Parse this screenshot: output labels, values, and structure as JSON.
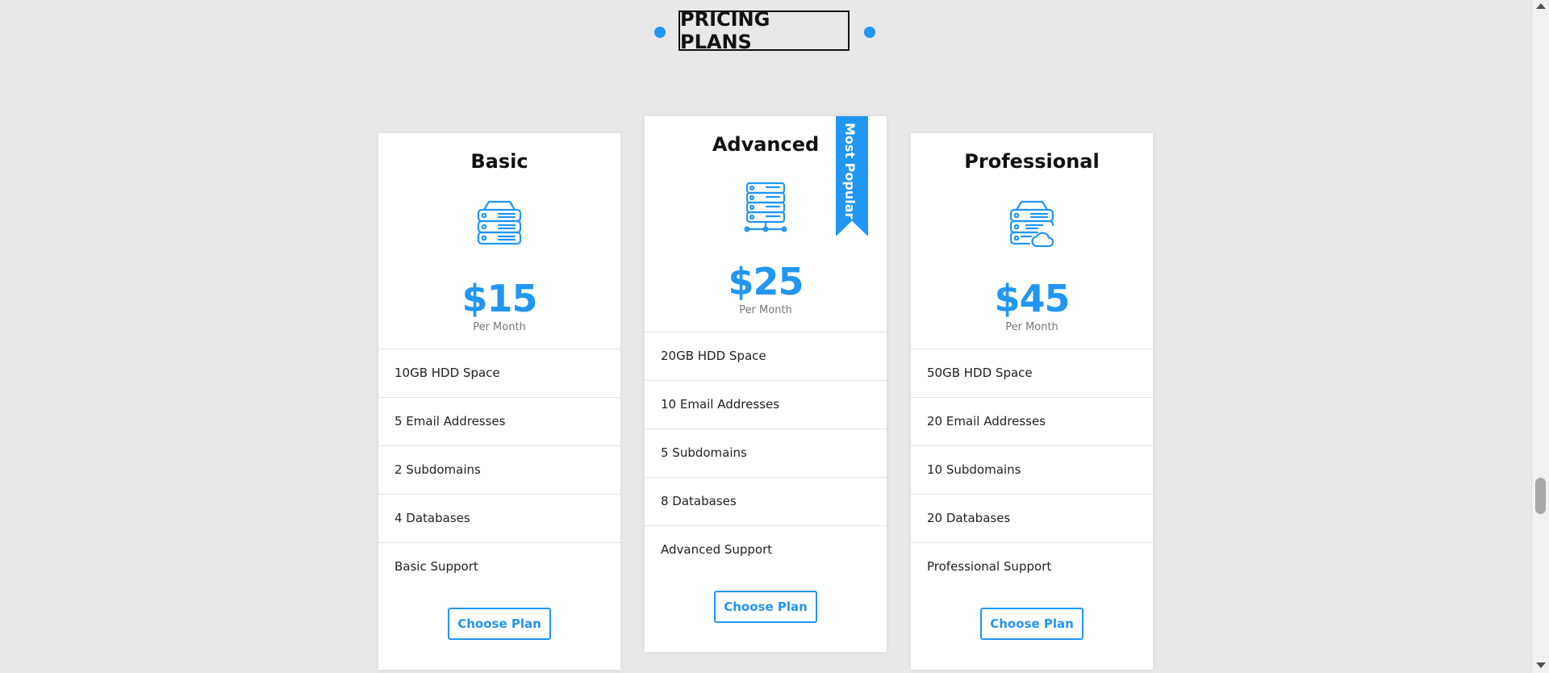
{
  "header": {
    "title": "PRICING PLANS"
  },
  "colors": {
    "accent": "#2196f3",
    "background": "#e8e8e8",
    "card": "#ffffff"
  },
  "plans": [
    {
      "name": "Basic",
      "icon": "server-stack-icon",
      "price": "$15",
      "period": "Per Month",
      "features": [
        "10GB HDD Space",
        "5 Email Addresses",
        "2 Subdomains",
        "4 Databases",
        "Basic Support"
      ],
      "button_label": "Choose Plan"
    },
    {
      "name": "Advanced",
      "icon": "server-network-icon",
      "price": "$25",
      "period": "Per Month",
      "badge": "Most Popular",
      "features": [
        "20GB HDD Space",
        "10 Email Addresses",
        "5 Subdomains",
        "8 Databases",
        "Advanced Support"
      ],
      "button_label": "Choose Plan"
    },
    {
      "name": "Professional",
      "icon": "server-cloud-icon",
      "price": "$45",
      "period": "Per Month",
      "features": [
        "50GB HDD Space",
        "20 Email Addresses",
        "10 Subdomains",
        "20 Databases",
        "Professional Support"
      ],
      "button_label": "Choose Plan"
    }
  ]
}
